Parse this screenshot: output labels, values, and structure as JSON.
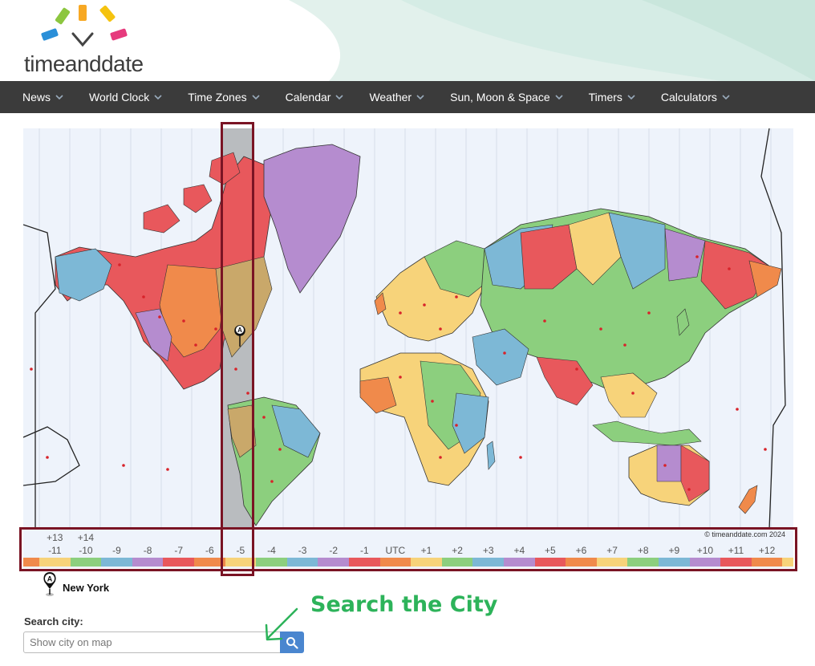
{
  "brand": {
    "name": "timeanddate"
  },
  "nav": {
    "items": [
      {
        "label": "News"
      },
      {
        "label": "World Clock"
      },
      {
        "label": "Time Zones"
      },
      {
        "label": "Calendar"
      },
      {
        "label": "Weather"
      },
      {
        "label": "Sun, Moon & Space"
      },
      {
        "label": "Timers"
      },
      {
        "label": "Calculators"
      }
    ]
  },
  "map": {
    "copyright": "© timeanddate.com 2024",
    "marker_letter": "A",
    "timezones": [
      {
        "top": "+13",
        "bottom": "-11",
        "color": "#f7d37a"
      },
      {
        "top": "+14",
        "bottom": "-10",
        "color": "#8ccf7e"
      },
      {
        "top": "",
        "bottom": "-9",
        "color": "#7db8d6"
      },
      {
        "top": "",
        "bottom": "-8",
        "color": "#b58ccf"
      },
      {
        "top": "",
        "bottom": "-7",
        "color": "#e8585c"
      },
      {
        "top": "",
        "bottom": "-6",
        "color": "#f08a4b"
      },
      {
        "top": "",
        "bottom": "-5",
        "color": "#f7d37a"
      },
      {
        "top": "",
        "bottom": "-4",
        "color": "#8ccf7e"
      },
      {
        "top": "",
        "bottom": "-3",
        "color": "#7db8d6"
      },
      {
        "top": "",
        "bottom": "-2",
        "color": "#b58ccf"
      },
      {
        "top": "",
        "bottom": "-1",
        "color": "#e8585c"
      },
      {
        "top": "",
        "bottom": "UTC",
        "color": "#f08a4b"
      },
      {
        "top": "",
        "bottom": "+1",
        "color": "#f7d37a"
      },
      {
        "top": "",
        "bottom": "+2",
        "color": "#8ccf7e"
      },
      {
        "top": "",
        "bottom": "+3",
        "color": "#7db8d6"
      },
      {
        "top": "",
        "bottom": "+4",
        "color": "#b58ccf"
      },
      {
        "top": "",
        "bottom": "+5",
        "color": "#e8585c"
      },
      {
        "top": "",
        "bottom": "+6",
        "color": "#f08a4b"
      },
      {
        "top": "",
        "bottom": "+7",
        "color": "#f7d37a"
      },
      {
        "top": "",
        "bottom": "+8",
        "color": "#8ccf7e"
      },
      {
        "top": "",
        "bottom": "+9",
        "color": "#7db8d6"
      },
      {
        "top": "",
        "bottom": "+10",
        "color": "#b58ccf"
      },
      {
        "top": "",
        "bottom": "+11",
        "color": "#e8585c"
      },
      {
        "top": "",
        "bottom": "+12",
        "color": "#f08a4b"
      }
    ],
    "highlighted_zone": "-5"
  },
  "legend": {
    "marker_letter": "A",
    "city": "New York"
  },
  "search": {
    "label": "Search city:",
    "placeholder": "Show city on map",
    "value": ""
  },
  "annotation": {
    "text": "Search the City",
    "color": "#2db35a"
  },
  "colors": {
    "nav_bg": "#3b3b3b",
    "highlight_border": "#7a1424",
    "search_button": "#4a86cf"
  }
}
